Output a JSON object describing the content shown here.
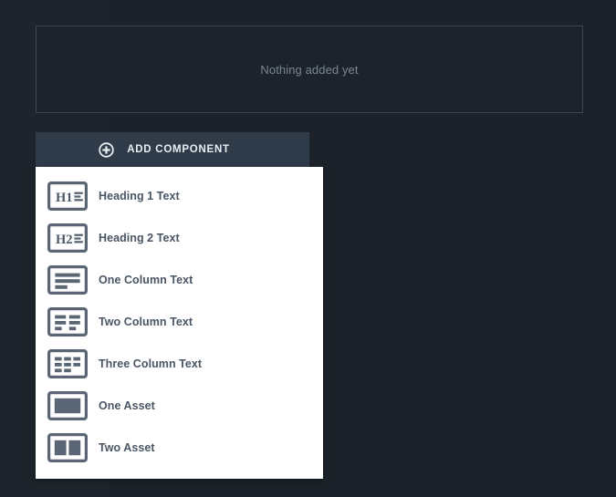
{
  "colors": {
    "background": "#1b2229",
    "panel_border": "#3b4653",
    "button_bg": "#2f3b49",
    "menu_bg": "#ffffff",
    "icon_color": "#5a6673",
    "menu_text": "#4a5664",
    "placeholder_text": "#7b8794"
  },
  "empty_panel": {
    "message": "Nothing added yet"
  },
  "add_button": {
    "label": "ADD COMPONENT",
    "icon": "plus-circle-icon"
  },
  "component_menu": {
    "items": [
      {
        "label": "Heading 1 Text",
        "icon": "heading-1-text-icon"
      },
      {
        "label": "Heading 2 Text",
        "icon": "heading-2-text-icon"
      },
      {
        "label": "One Column Text",
        "icon": "one-column-text-icon"
      },
      {
        "label": "Two Column Text",
        "icon": "two-column-text-icon"
      },
      {
        "label": "Three Column Text",
        "icon": "three-column-text-icon"
      },
      {
        "label": "One Asset",
        "icon": "one-asset-icon"
      },
      {
        "label": "Two Asset",
        "icon": "two-asset-icon"
      }
    ]
  }
}
